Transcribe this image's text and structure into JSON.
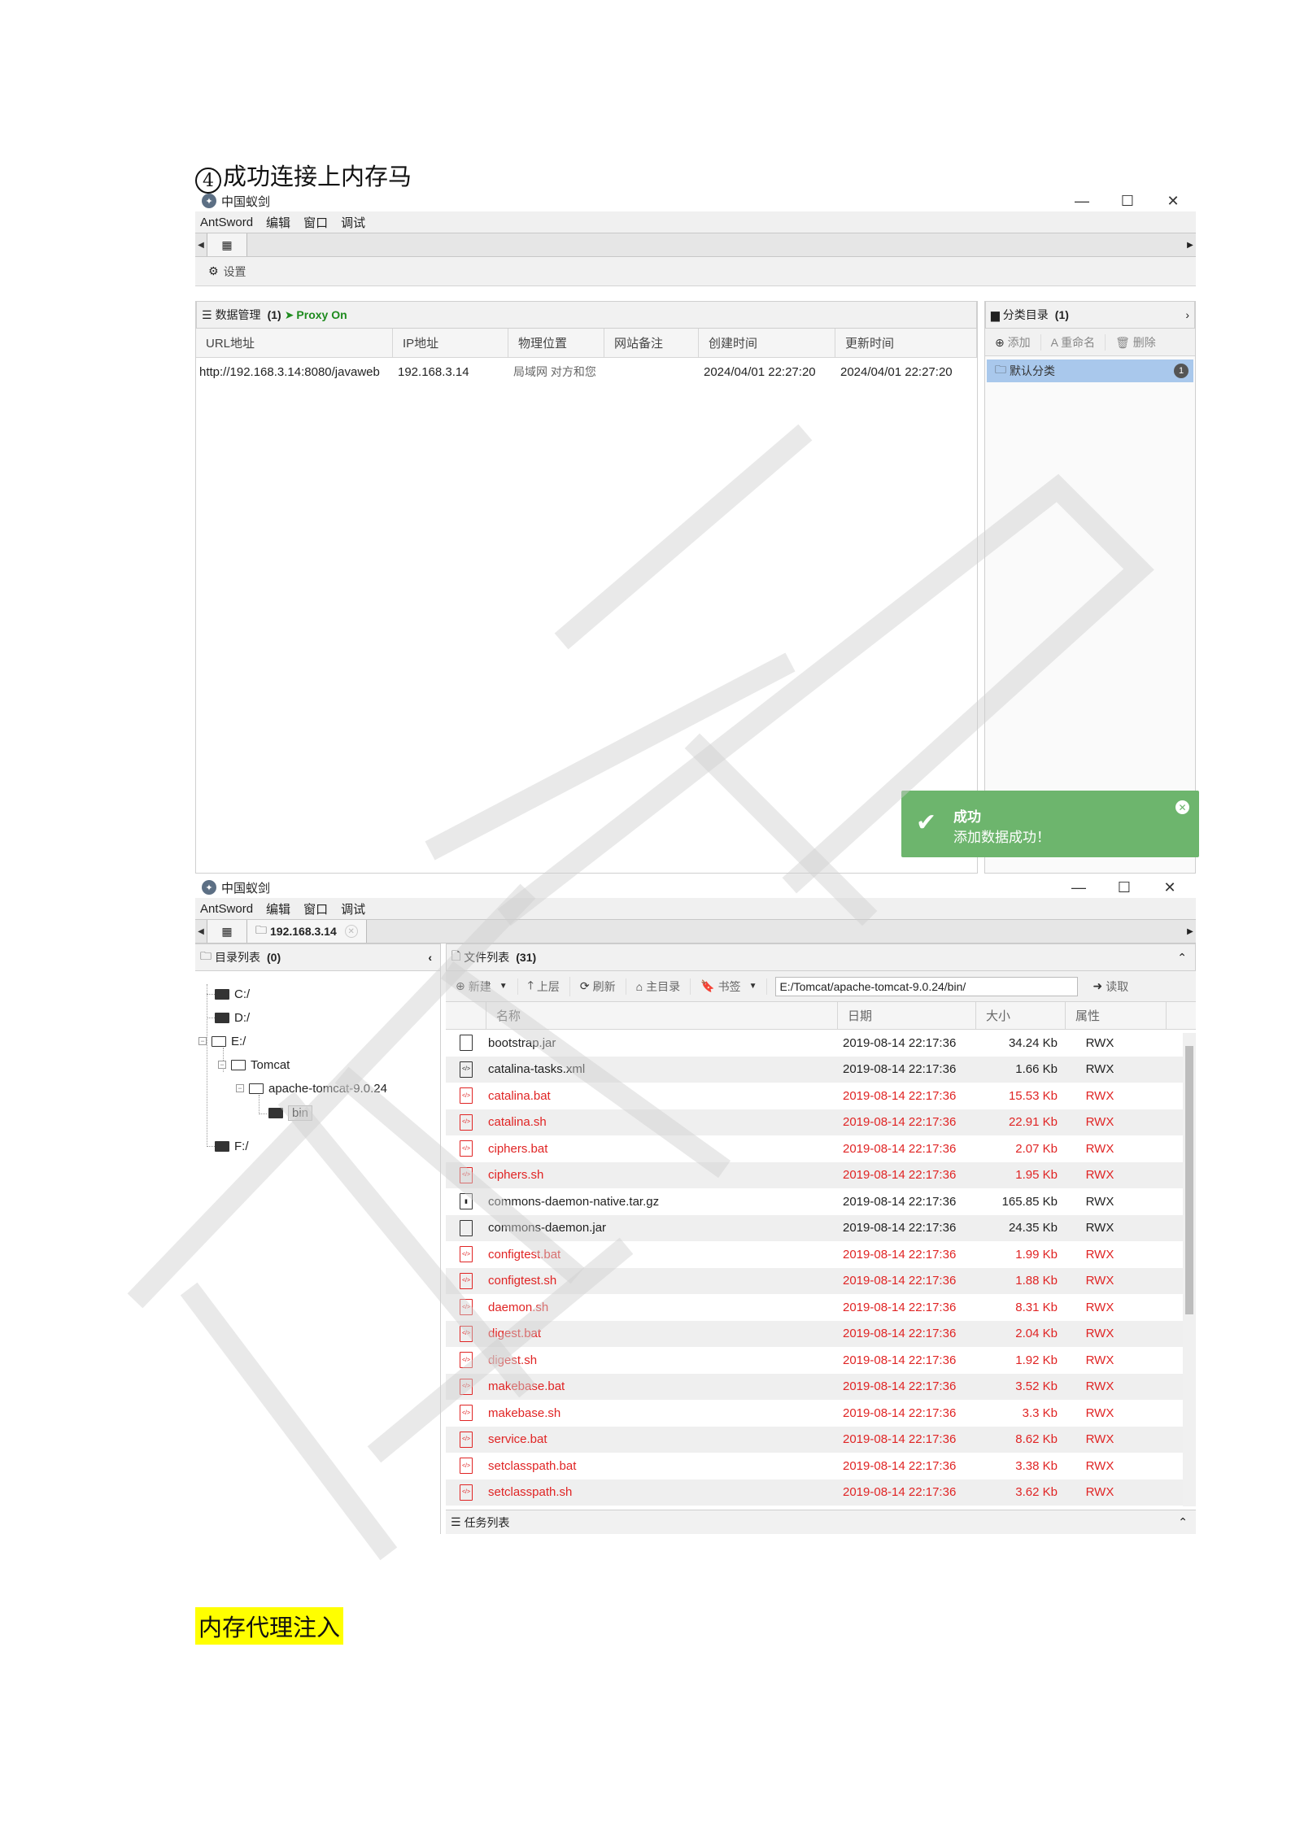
{
  "doc": {
    "heading_num": "4",
    "heading_text": "成功连接上内存马",
    "section_title": "内存代理注入"
  },
  "window1": {
    "title": "中国蚁剑",
    "menu": [
      "AntSword",
      "编辑",
      "窗口",
      "调试"
    ],
    "settings_label": "设置",
    "data_panel": {
      "label": "数据管理",
      "count": "(1)",
      "proxy": "Proxy On"
    },
    "columns": [
      "URL地址",
      "IP地址",
      "物理位置",
      "网站备注",
      "创建时间",
      "更新时间"
    ],
    "rows": [
      {
        "url": "http://192.168.3.14:8080/javaweb",
        "ip": "192.168.3.14",
        "location": "局域网 对方和您",
        "note": "",
        "created": "2024/04/01 22:27:20",
        "updated": "2024/04/01 22:27:20"
      }
    ],
    "category_panel": {
      "label": "分类目录",
      "count": "(1)",
      "add": "添加",
      "rename": "重命名",
      "delete": "删除",
      "default_category": "默认分类",
      "default_count": "1"
    },
    "toast": {
      "title": "成功",
      "message": "添加数据成功！"
    }
  },
  "window2": {
    "title": "中国蚁剑",
    "menu": [
      "AntSword",
      "编辑",
      "窗口",
      "调试"
    ],
    "host_tab": "192.168.3.14",
    "dir_panel": {
      "label": "目录列表",
      "count": "(0)"
    },
    "tree": {
      "c": "C:/",
      "d": "D:/",
      "e": "E:/",
      "tomcat": "Tomcat",
      "apache": "apache-tomcat-9.0.24",
      "bin": "bin",
      "f": "F:/"
    },
    "file_panel": {
      "label": "文件列表",
      "count": "(31)"
    },
    "toolbar": {
      "new": "新建",
      "up": "上层",
      "refresh": "刷新",
      "home": "主目录",
      "bookmark": "书签",
      "path": "E:/Tomcat/apache-tomcat-9.0.24/bin/",
      "read": "读取"
    },
    "file_columns": [
      "名称",
      "日期",
      "大小",
      "属性"
    ],
    "files": [
      {
        "name": "bootstrap.jar",
        "date": "2019-08-14 22:17:36",
        "size": "34.24 Kb",
        "attr": "RWX",
        "red": false,
        "icon": "file-icon"
      },
      {
        "name": "catalina-tasks.xml",
        "date": "2019-08-14 22:17:36",
        "size": "1.66 Kb",
        "attr": "RWX",
        "red": false,
        "icon": "code-file-icon"
      },
      {
        "name": "catalina.bat",
        "date": "2019-08-14 22:17:36",
        "size": "15.53 Kb",
        "attr": "RWX",
        "red": true,
        "icon": "code-file-icon"
      },
      {
        "name": "catalina.sh",
        "date": "2019-08-14 22:17:36",
        "size": "22.91 Kb",
        "attr": "RWX",
        "red": true,
        "icon": "code-file-icon"
      },
      {
        "name": "ciphers.bat",
        "date": "2019-08-14 22:17:36",
        "size": "2.07 Kb",
        "attr": "RWX",
        "red": true,
        "icon": "code-file-icon"
      },
      {
        "name": "ciphers.sh",
        "date": "2019-08-14 22:17:36",
        "size": "1.95 Kb",
        "attr": "RWX",
        "red": true,
        "icon": "code-file-icon"
      },
      {
        "name": "commons-daemon-native.tar.gz",
        "date": "2019-08-14 22:17:36",
        "size": "165.85 Kb",
        "attr": "RWX",
        "red": false,
        "icon": "archive-file-icon"
      },
      {
        "name": "commons-daemon.jar",
        "date": "2019-08-14 22:17:36",
        "size": "24.35 Kb",
        "attr": "RWX",
        "red": false,
        "icon": "file-icon"
      },
      {
        "name": "configtest.bat",
        "date": "2019-08-14 22:17:36",
        "size": "1.99 Kb",
        "attr": "RWX",
        "red": true,
        "icon": "code-file-icon"
      },
      {
        "name": "configtest.sh",
        "date": "2019-08-14 22:17:36",
        "size": "1.88 Kb",
        "attr": "RWX",
        "red": true,
        "icon": "code-file-icon"
      },
      {
        "name": "daemon.sh",
        "date": "2019-08-14 22:17:36",
        "size": "8.31 Kb",
        "attr": "RWX",
        "red": true,
        "icon": "code-file-icon"
      },
      {
        "name": "digest.bat",
        "date": "2019-08-14 22:17:36",
        "size": "2.04 Kb",
        "attr": "RWX",
        "red": true,
        "icon": "code-file-icon"
      },
      {
        "name": "digest.sh",
        "date": "2019-08-14 22:17:36",
        "size": "1.92 Kb",
        "attr": "RWX",
        "red": true,
        "icon": "code-file-icon"
      },
      {
        "name": "makebase.bat",
        "date": "2019-08-14 22:17:36",
        "size": "3.52 Kb",
        "attr": "RWX",
        "red": true,
        "icon": "code-file-icon"
      },
      {
        "name": "makebase.sh",
        "date": "2019-08-14 22:17:36",
        "size": "3.3 Kb",
        "attr": "RWX",
        "red": true,
        "icon": "code-file-icon"
      },
      {
        "name": "service.bat",
        "date": "2019-08-14 22:17:36",
        "size": "8.62 Kb",
        "attr": "RWX",
        "red": true,
        "icon": "code-file-icon"
      },
      {
        "name": "setclasspath.bat",
        "date": "2019-08-14 22:17:36",
        "size": "3.38 Kb",
        "attr": "RWX",
        "red": true,
        "icon": "code-file-icon"
      },
      {
        "name": "setclasspath.sh",
        "date": "2019-08-14 22:17:36",
        "size": "3.62 Kb",
        "attr": "RWX",
        "red": true,
        "icon": "code-file-icon"
      }
    ],
    "task_panel": {
      "label": "任务列表"
    }
  },
  "colors": {
    "proxy_green": "#1e8b1e",
    "toast_green": "#6db56d",
    "red_file": "#e02424",
    "selected_category": "#a9c8ec",
    "highlight": "#ffff00"
  }
}
